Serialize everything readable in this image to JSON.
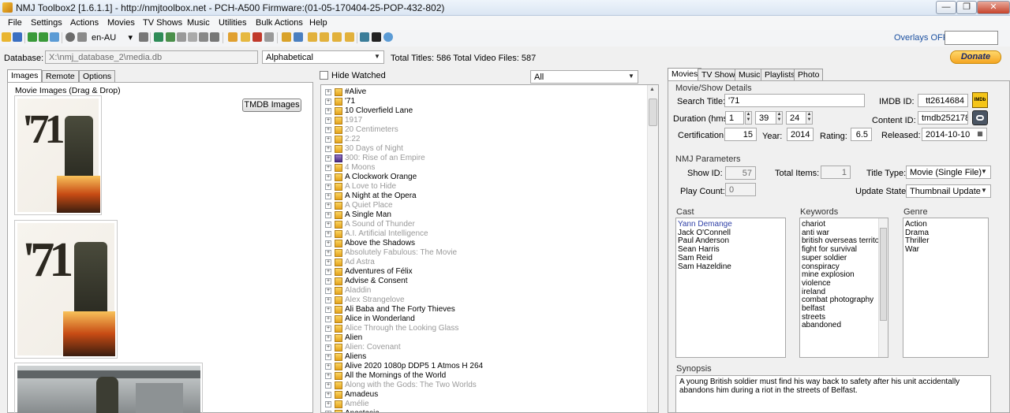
{
  "window": {
    "title": "NMJ Toolbox2 [1.6.1.1] - http://nmjtoolbox.net - PCH-A500 Firmware:(01-05-170404-25-POP-432-802)",
    "minimize": "—",
    "maximize": "❐",
    "close": "✕"
  },
  "menu": [
    "File",
    "Settings",
    "Actions",
    "Movies",
    "TV Shows",
    "Music",
    "Utilities",
    "Bulk Actions",
    "Help"
  ],
  "toolbar": {
    "language": "en-AU",
    "overlays_label": "Overlays OFF",
    "overlays_value": ""
  },
  "database": {
    "label": "Database:",
    "path": "X:\\nmj_database_2\\media.db",
    "sort": "Alphabetical",
    "totals": "Total Titles: 586 Total Video Files: 587",
    "donate": "Donate"
  },
  "left_panel": {
    "tabs": [
      "Images",
      "Remote",
      "Options"
    ],
    "section_title": "Movie Images (Drag & Drop)",
    "tmdb_button": "TMDB Images",
    "poster_text": "'71"
  },
  "list": {
    "hide_watched_label": "Hide Watched",
    "filter": "All",
    "items": [
      {
        "title": "#Alive",
        "grey": false,
        "type": "movie"
      },
      {
        "title": "'71",
        "grey": false,
        "type": "movie"
      },
      {
        "title": "10 Cloverfield Lane",
        "grey": false,
        "type": "movie"
      },
      {
        "title": "1917",
        "grey": true,
        "type": "movie"
      },
      {
        "title": "20 Centimeters",
        "grey": true,
        "type": "movie"
      },
      {
        "title": "2:22",
        "grey": true,
        "type": "movie"
      },
      {
        "title": "30 Days of Night",
        "grey": true,
        "type": "movie"
      },
      {
        "title": "300: Rise of an Empire",
        "grey": true,
        "type": "tv"
      },
      {
        "title": "4 Moons",
        "grey": true,
        "type": "movie"
      },
      {
        "title": "A Clockwork Orange",
        "grey": false,
        "type": "movie"
      },
      {
        "title": "A Love to Hide",
        "grey": true,
        "type": "movie"
      },
      {
        "title": "A Night at the Opera",
        "grey": false,
        "type": "movie"
      },
      {
        "title": "A Quiet Place",
        "grey": true,
        "type": "movie"
      },
      {
        "title": "A Single Man",
        "grey": false,
        "type": "movie"
      },
      {
        "title": "A Sound of Thunder",
        "grey": true,
        "type": "movie"
      },
      {
        "title": "A.I. Artificial Intelligence",
        "grey": true,
        "type": "movie"
      },
      {
        "title": "Above the Shadows",
        "grey": false,
        "type": "movie"
      },
      {
        "title": "Absolutely Fabulous: The Movie",
        "grey": true,
        "type": "movie"
      },
      {
        "title": "Ad Astra",
        "grey": true,
        "type": "movie"
      },
      {
        "title": "Adventures of Félix",
        "grey": false,
        "type": "movie"
      },
      {
        "title": "Advise & Consent",
        "grey": false,
        "type": "movie"
      },
      {
        "title": "Aladdin",
        "grey": true,
        "type": "movie"
      },
      {
        "title": "Alex Strangelove",
        "grey": true,
        "type": "movie"
      },
      {
        "title": "Ali Baba and The Forty Thieves",
        "grey": false,
        "type": "movie"
      },
      {
        "title": "Alice in Wonderland",
        "grey": false,
        "type": "movie"
      },
      {
        "title": "Alice Through the Looking Glass",
        "grey": true,
        "type": "movie"
      },
      {
        "title": "Alien",
        "grey": false,
        "type": "movie"
      },
      {
        "title": "Alien: Covenant",
        "grey": true,
        "type": "movie"
      },
      {
        "title": "Aliens",
        "grey": false,
        "type": "movie"
      },
      {
        "title": "Alive 2020 1080p DDP5 1 Atmos H 264",
        "grey": false,
        "type": "movie"
      },
      {
        "title": "All the Mornings of the World",
        "grey": false,
        "type": "movie"
      },
      {
        "title": "Along with the Gods: The Two Worlds",
        "grey": true,
        "type": "movie"
      },
      {
        "title": "Amadeus",
        "grey": false,
        "type": "movie"
      },
      {
        "title": "Amélie",
        "grey": true,
        "type": "movie"
      },
      {
        "title": "Anastasia",
        "grey": false,
        "type": "movie"
      }
    ]
  },
  "right_panel": {
    "tabs": [
      "Movies",
      "TV Shows",
      "Music",
      "Playlists",
      "Photo"
    ],
    "details_title": "Movie/Show Details",
    "search_title_label": "Search Title:",
    "search_title_value": "'71",
    "imdb_label": "IMDB ID:",
    "imdb_value": "tt2614684",
    "imdb_badge": "IMDb",
    "duration_label": "Duration (hms):",
    "duration_h": "1",
    "duration_m": "39",
    "duration_s": "24",
    "content_id_label": "Content ID:",
    "content_id_value": "tmdb252178",
    "certification_label": "Certification:",
    "certification_value": "15",
    "year_label": "Year:",
    "year_value": "2014",
    "rating_label": "Rating:",
    "rating_value": "6.5",
    "released_label": "Released:",
    "released_value": "2014-10-10",
    "nmj_title": "NMJ Parameters",
    "show_id_label": "Show ID:",
    "show_id_value": "57",
    "total_items_label": "Total Items:",
    "total_items_value": "1",
    "title_type_label": "Title Type:",
    "title_type_value": "Movie (Single File)",
    "play_count_label": "Play Count:",
    "play_count_value": "0",
    "update_state_label": "Update State:",
    "update_state_value": "Thumbnail Update",
    "cast_title": "Cast",
    "cast": [
      "Yann Demange",
      "Jack O'Connell",
      "Paul Anderson",
      "Sean Harris",
      "Sam Reid",
      "Sam Hazeldine"
    ],
    "keywords_title": "Keywords",
    "keywords": [
      "chariot",
      "anti war",
      "british overseas territory",
      "fight for survival",
      "super soldier",
      "conspiracy",
      "mine explosion",
      " violence",
      "ireland",
      "combat photography",
      "belfast",
      "streets",
      "abandoned"
    ],
    "genre_title": "Genre",
    "genres": [
      "Action",
      "Drama",
      "Thriller",
      "War"
    ],
    "synopsis_title": "Synopsis",
    "synopsis": "A young British soldier must find his way back to safety after his unit accidentally abandons him during a riot in the streets of Belfast."
  }
}
